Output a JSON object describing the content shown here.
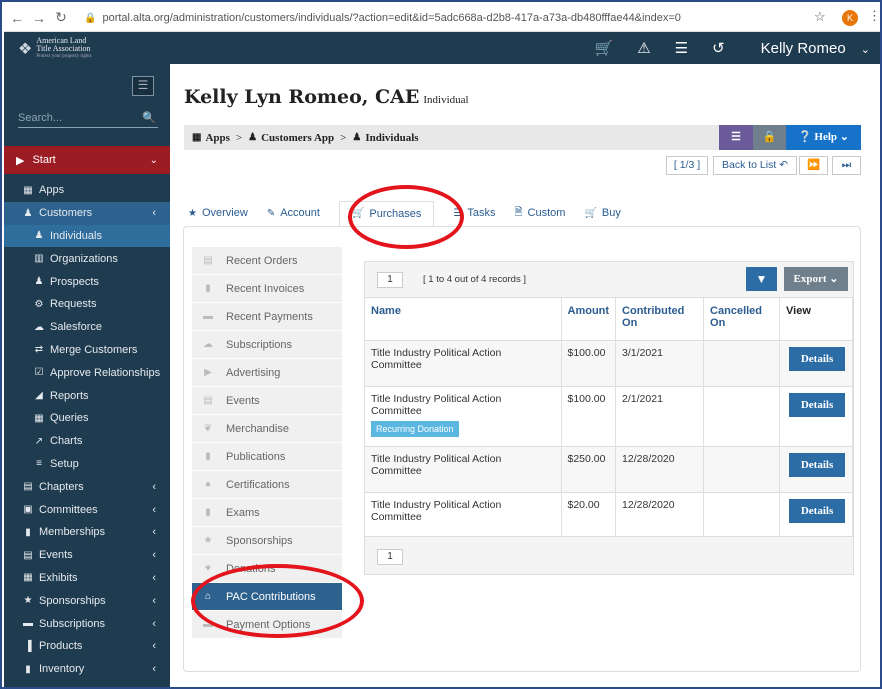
{
  "browser": {
    "url": "portal.alta.org/administration/customers/individuals/?action=edit&id=5adc668a-d2b8-417a-a73a-db480fffae44&index=0",
    "avatar_letter": "K"
  },
  "topbar": {
    "logo_line1": "American Land",
    "logo_line2": "Title Association",
    "logo_tagline": "Protect your property rights",
    "user_name": "Kelly Romeo"
  },
  "sidebar": {
    "search_placeholder": "Search...",
    "start_label": "Start",
    "items": [
      {
        "label": "Apps",
        "icon": "grid-icon"
      },
      {
        "label": "Customers",
        "icon": "users-icon"
      },
      {
        "label": "Individuals",
        "icon": "user-icon"
      },
      {
        "label": "Organizations",
        "icon": "building-icon"
      },
      {
        "label": "Prospects",
        "icon": "users-icon"
      },
      {
        "label": "Requests",
        "icon": "gear-icon"
      },
      {
        "label": "Salesforce",
        "icon": "cloud-icon"
      },
      {
        "label": "Merge Customers",
        "icon": "swap-icon"
      },
      {
        "label": "Approve Relationships",
        "icon": "check-icon"
      },
      {
        "label": "Reports",
        "icon": "area-chart-icon"
      },
      {
        "label": "Queries",
        "icon": "table-icon"
      },
      {
        "label": "Charts",
        "icon": "line-chart-icon"
      },
      {
        "label": "Setup",
        "icon": "list-icon"
      },
      {
        "label": "Chapters",
        "icon": "calendar-icon"
      },
      {
        "label": "Committees",
        "icon": "briefcase-icon"
      },
      {
        "label": "Memberships",
        "icon": "bookmark-icon"
      },
      {
        "label": "Events",
        "icon": "events-icon"
      },
      {
        "label": "Exhibits",
        "icon": "grid-icon"
      },
      {
        "label": "Sponsorships",
        "icon": "star-icon"
      },
      {
        "label": "Subscriptions",
        "icon": "drive-icon"
      },
      {
        "label": "Products",
        "icon": "barcode-icon"
      },
      {
        "label": "Inventory",
        "icon": "inventory-icon"
      }
    ]
  },
  "header": {
    "name": "Kelly Lyn Romeo, CAE",
    "kind": "Individual"
  },
  "breadcrumb": {
    "apps": "Apps",
    "customers_app": "Customers App",
    "individuals": "Individuals",
    "help": "Help"
  },
  "pager": {
    "position": "[ 1/3 ]",
    "back": "Back to List"
  },
  "tabs": [
    "Overview",
    "Account",
    "Purchases",
    "Tasks",
    "Custom",
    "Buy"
  ],
  "purchases_menu": [
    "Recent Orders",
    "Recent Invoices",
    "Recent Payments",
    "Subscriptions",
    "Advertising",
    "Events",
    "Merchandise",
    "Publications",
    "Certifications",
    "Exams",
    "Sponsorships",
    "Donations",
    "PAC Contributions",
    "Payment Options"
  ],
  "grid": {
    "page": "1",
    "records": "[ 1 to 4 out of 4 records ]",
    "export": "Export",
    "columns": [
      "Name",
      "Amount",
      "Contributed On",
      "Cancelled On",
      "View"
    ],
    "rows": [
      {
        "name": "Title Industry Political Action Committee",
        "amount": "$100.00",
        "date": "3/1/2021",
        "cancelled": "",
        "badge": ""
      },
      {
        "name": "Title Industry Political Action Committee",
        "amount": "$100.00",
        "date": "2/1/2021",
        "cancelled": "",
        "badge": "Recurring Donation"
      },
      {
        "name": "Title Industry Political Action Committee",
        "amount": "$250.00",
        "date": "12/28/2020",
        "cancelled": "",
        "badge": ""
      },
      {
        "name": "Title Industry Political Action Committee",
        "amount": "$20.00",
        "date": "12/28/2020",
        "cancelled": "",
        "badge": ""
      }
    ],
    "details_label": "Details",
    "footer_page": "1"
  },
  "colors": {
    "sidebar_bg": "#1f3b50",
    "start_bg": "#9c1c24",
    "accent_blue": "#2d6da6",
    "annotation_red": "#e3141c"
  }
}
